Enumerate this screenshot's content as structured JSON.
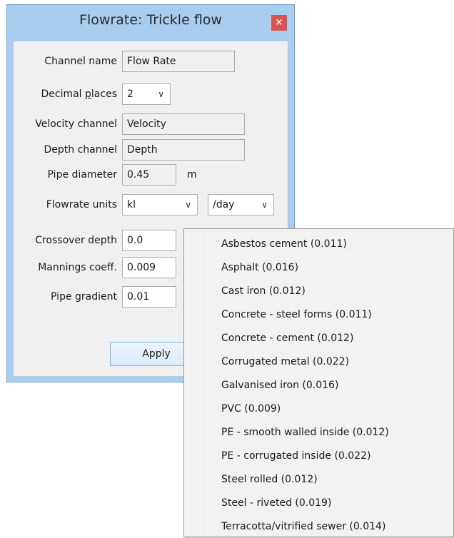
{
  "window": {
    "title": "Flowrate: Trickle flow",
    "close_glyph": "×"
  },
  "form": {
    "channel_name": {
      "label": "Channel name",
      "value": "Flow Rate"
    },
    "decimal_places": {
      "label_pre": "Decimal ",
      "label_ul": "p",
      "label_post": "laces",
      "value": "2"
    },
    "velocity_channel": {
      "label": "Velocity channel",
      "value": "Velocity"
    },
    "depth_channel": {
      "label": "Depth channel",
      "value": "Depth"
    },
    "pipe_diameter": {
      "label": "Pipe diameter",
      "value": "0.45",
      "unit": "m"
    },
    "flowrate_units": {
      "label": "Flowrate units",
      "volume_value": "kl",
      "time_value": "/day"
    },
    "crossover_depth": {
      "label": "Crossover depth",
      "value": "0.0"
    },
    "mannings_coeff": {
      "label": "Mannings coeff.",
      "value": "0.009"
    },
    "pipe_gradient": {
      "label": "Pipe gradient",
      "value": "0.01"
    },
    "apply_label": "Apply"
  },
  "materials_menu": {
    "items": [
      "Asbestos cement (0.011)",
      "Asphalt (0.016)",
      "Cast iron (0.012)",
      "Concrete - steel forms (0.011)",
      "Concrete - cement (0.012)",
      "Corrugated metal (0.022)",
      "Galvanised iron (0.016)",
      "PVC (0.009)",
      "PE - smooth walled inside (0.012)",
      "PE - corrugated inside (0.022)",
      "Steel rolled (0.012)",
      "Steel - riveted (0.019)",
      "Terracotta/vitrified sewer (0.014)"
    ]
  },
  "colors": {
    "window_frame": "#a9cdef",
    "close_button": "#d9534f",
    "client_bg": "#f0f0f0",
    "menu_bg": "#f2f2f2"
  }
}
